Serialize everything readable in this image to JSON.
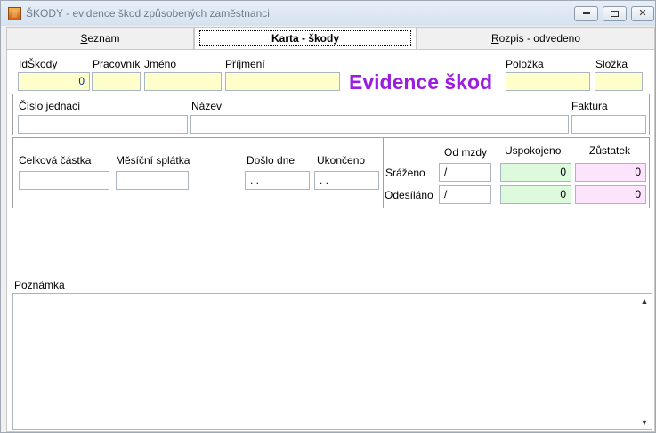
{
  "window": {
    "title": "ŠKODY - evidence škod způsobených zaměstnanci",
    "min_glyph": "",
    "max_glyph": "",
    "close_glyph": "✕"
  },
  "tabs": [
    {
      "label": "Seznam",
      "underline": "S",
      "rest": "eznam"
    },
    {
      "label": "Karta - škody"
    },
    {
      "label": "Rozpis - odvedeno",
      "underline": "R",
      "rest": "ozpis - odvedeno"
    }
  ],
  "form": {
    "heading": "Evidence škod",
    "id_skody": {
      "label": "IdŠkody",
      "value": "0"
    },
    "pracovnik": {
      "label": "Pracovník",
      "value": ""
    },
    "jmeno": {
      "label": "Jméno",
      "value": ""
    },
    "prijmeni": {
      "label": "Příjmení",
      "value": ""
    },
    "polozka": {
      "label": "Položka",
      "value": ""
    },
    "slozka": {
      "label": "Složka",
      "value": ""
    },
    "cislo_jednaci": {
      "label": "Číslo jednací",
      "value": ""
    },
    "nazev": {
      "label": "Název",
      "value": ""
    },
    "faktura": {
      "label": "Faktura",
      "value": ""
    },
    "celkova_castka": {
      "label": "Celková částka",
      "value": ""
    },
    "mesicni_splatka": {
      "label": "Měsíční splátka",
      "value": ""
    },
    "doslo_dne": {
      "label": "Došlo dne",
      "value": " .  ."
    },
    "ukonceno": {
      "label": "Ukončeno",
      "value": " .  ."
    },
    "col_od_mzdy": "Od mzdy",
    "col_uspokojeno": "Uspokojeno",
    "col_zustatek": "Zůstatek",
    "srazeno": {
      "label": "Sráženo",
      "od_mzdy": "/",
      "uspokojeno": "0",
      "zustatek": "0"
    },
    "odesilano": {
      "label": "Odesíláno",
      "od_mzdy": "/",
      "uspokojeno": "0",
      "zustatek": "0"
    },
    "poznamka": {
      "label": "Poznámka",
      "value": ""
    }
  },
  "colors": {
    "heading": "#9b1ee0",
    "yellow_field": "#ffffcc",
    "green_field": "#ddfadd",
    "pink_field": "#fce5fc"
  },
  "icons": {
    "app": "app-icon",
    "scroll_up": "▲",
    "scroll_down": "▼"
  }
}
